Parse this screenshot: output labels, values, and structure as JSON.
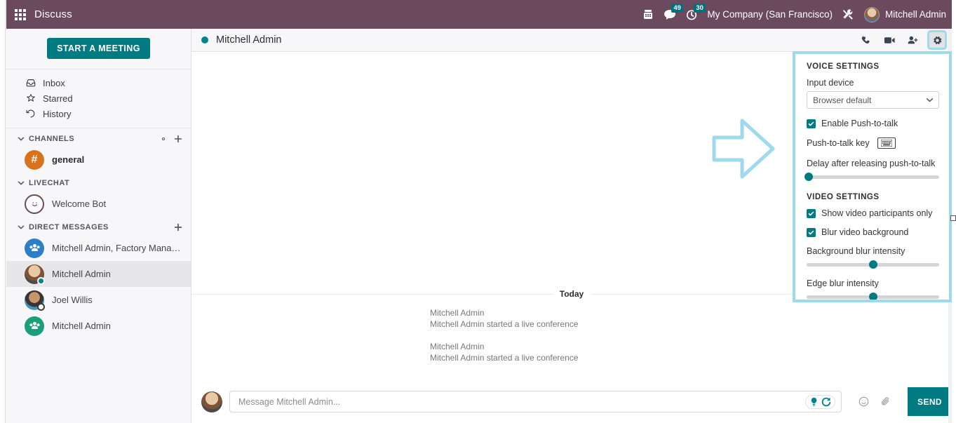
{
  "navbar": {
    "apps_icon": "apps-grid-icon",
    "title": "Discuss",
    "phone_icon": "telephone-icon",
    "messages_icon": "chat-bubble-icon",
    "messages_badge": "49",
    "activities_icon": "clock-icon",
    "activities_badge": "30",
    "company": "My Company (San Francisco)",
    "tools_icon": "tools-icon",
    "avatar": "user-avatar",
    "user": "Mitchell Admin"
  },
  "sidebar": {
    "start_meeting_label": "START A MEETING",
    "mailboxes": [
      {
        "label": "Inbox",
        "icon": "inbox-icon"
      },
      {
        "label": "Starred",
        "icon": "star-icon"
      },
      {
        "label": "History",
        "icon": "history-icon"
      }
    ],
    "sections": [
      {
        "title": "CHANNELS",
        "actions": [
          "gear-icon",
          "plus-icon"
        ],
        "items": [
          {
            "name": "general",
            "avatar": "hash",
            "status": "none"
          }
        ]
      },
      {
        "title": "LIVECHAT",
        "actions": [],
        "items": [
          {
            "name": "Welcome Bot",
            "avatar": "bot",
            "status": "none"
          }
        ]
      },
      {
        "title": "DIRECT MESSAGES",
        "actions": [
          "plus-icon"
        ],
        "items": [
          {
            "name": "Mitchell Admin, Factory Manager, inv...",
            "avatar": "group-blue",
            "status": "none"
          },
          {
            "name": "Mitchell Admin",
            "avatar": "photo-a",
            "status": "online"
          },
          {
            "name": "Joel Willis",
            "avatar": "photo-b",
            "status": "away"
          },
          {
            "name": "Mitchell Admin",
            "avatar": "group-green",
            "status": "none"
          }
        ]
      }
    ]
  },
  "chat": {
    "title": "Mitchell Admin",
    "status": "online",
    "actions": [
      {
        "name": "call-button",
        "icon": "phone-icon"
      },
      {
        "name": "video-call-button",
        "icon": "video-camera-icon"
      },
      {
        "name": "add-users-button",
        "icon": "add-person-icon"
      },
      {
        "name": "settings-button",
        "icon": "gear-icon"
      }
    ],
    "day_separator": "Today",
    "messages": [
      {
        "author": "Mitchell Admin",
        "text": "Mitchell Admin started a live conference"
      },
      {
        "author": "Mitchell Admin",
        "text": "Mitchell Admin started a live conference"
      }
    ],
    "composer": {
      "placeholder": "Message Mitchell Admin...",
      "value": "",
      "suggestion_icons": [
        "lightbulb-icon",
        "command-icon"
      ],
      "emoji_icon": "emoji-icon",
      "attach_icon": "paperclip-icon",
      "send_label": "SEND"
    }
  },
  "settings": {
    "voice": {
      "title": "VOICE SETTINGS",
      "input_device_label": "Input device",
      "input_device_value": "Browser default",
      "push_to_talk_label": "Enable Push-to-talk",
      "push_to_talk_checked": true,
      "ptt_key_label": "Push-to-talk key",
      "ptt_key_icon": "keyboard-icon",
      "delay_label": "Delay after releasing push-to-talk",
      "delay_value": 0
    },
    "video": {
      "title": "VIDEO SETTINGS",
      "participants_only_label": "Show video participants only",
      "participants_only_checked": true,
      "blur_background_label": "Blur video background",
      "blur_background_checked": true,
      "background_blur_label": "Background blur intensity",
      "background_blur_value": 50,
      "edge_blur_label": "Edge blur intensity",
      "edge_blur_value": 50
    }
  },
  "annotation": {
    "arrow": "right-arrow-annotation",
    "color": "#9fd9ec"
  }
}
